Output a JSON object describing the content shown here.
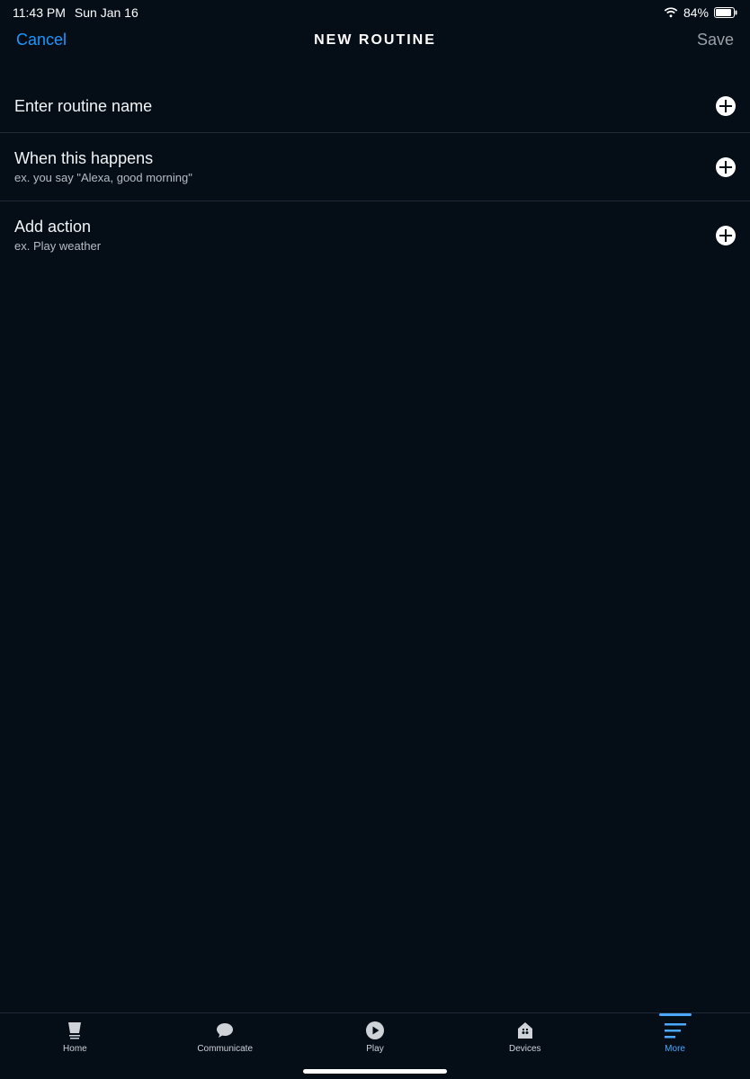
{
  "status": {
    "time": "11:43 PM",
    "date": "Sun Jan 16",
    "battery": "84%"
  },
  "nav": {
    "cancel": "Cancel",
    "title": "NEW ROUTINE",
    "save": "Save"
  },
  "rows": {
    "name": {
      "title": "Enter routine name"
    },
    "trigger": {
      "title": "When this happens",
      "sub": "ex. you say \"Alexa, good morning\""
    },
    "action": {
      "title": "Add action",
      "sub": "ex. Play weather"
    }
  },
  "tabs": {
    "home": "Home",
    "communicate": "Communicate",
    "play": "Play",
    "devices": "Devices",
    "more": "More"
  }
}
